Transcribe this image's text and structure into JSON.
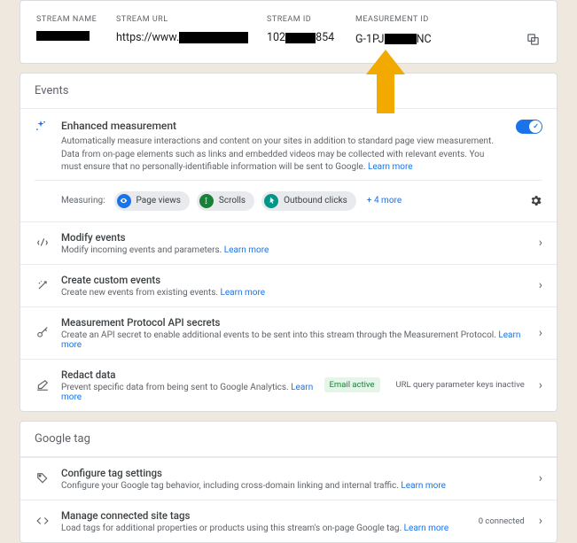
{
  "stream_header": {
    "cols": {
      "name": {
        "label": "STREAM NAME"
      },
      "url": {
        "label": "STREAM URL",
        "prefix": "https://www."
      },
      "id": {
        "label": "STREAM ID",
        "prefix": "102",
        "suffix": "854"
      },
      "mid": {
        "label": "MEASUREMENT ID",
        "prefix": "G-1PJ",
        "suffix": "NC"
      }
    }
  },
  "sections": {
    "events": {
      "title": "Events"
    },
    "gtag": {
      "title": "Google tag"
    }
  },
  "enhanced": {
    "title": "Enhanced measurement",
    "desc": "Automatically measure interactions and content on your sites in addition to standard page view measurement. Data from on-page elements such as links and embedded videos may be collected with relevant events. You must ensure that no personally-identifiable information will be sent to Google. ",
    "learn": "Learn more",
    "measuring_label": "Measuring:",
    "pills": [
      "Page views",
      "Scrolls",
      "Outbound clicks"
    ],
    "more": "+ 4 more"
  },
  "event_rows": {
    "modify": {
      "title": "Modify events",
      "desc": "Modify incoming events and parameters. ",
      "learn": "Learn more"
    },
    "create": {
      "title": "Create custom events",
      "desc": "Create new events from existing events. ",
      "learn": "Learn more"
    },
    "mpapi": {
      "title": "Measurement Protocol API secrets",
      "desc": "Create an API secret to enable additional events to be sent into this stream through the Measurement Protocol. ",
      "learn": "Learn more"
    },
    "redact": {
      "title": "Redact data",
      "desc": "Prevent specific data from being sent to Google Analytics. ",
      "learn": "Learn more",
      "badge1": "Email active",
      "badge2": "URL query parameter keys inactive"
    }
  },
  "gtag_rows": {
    "config": {
      "title": "Configure tag settings",
      "desc": "Configure your Google tag behavior, including cross-domain linking and internal traffic. ",
      "learn": "Learn more"
    },
    "manage": {
      "title": "Manage connected site tags",
      "desc": "Load tags for additional properties or products using this stream's on-page Google tag. ",
      "learn": "Learn more",
      "right": "0 connected"
    }
  }
}
